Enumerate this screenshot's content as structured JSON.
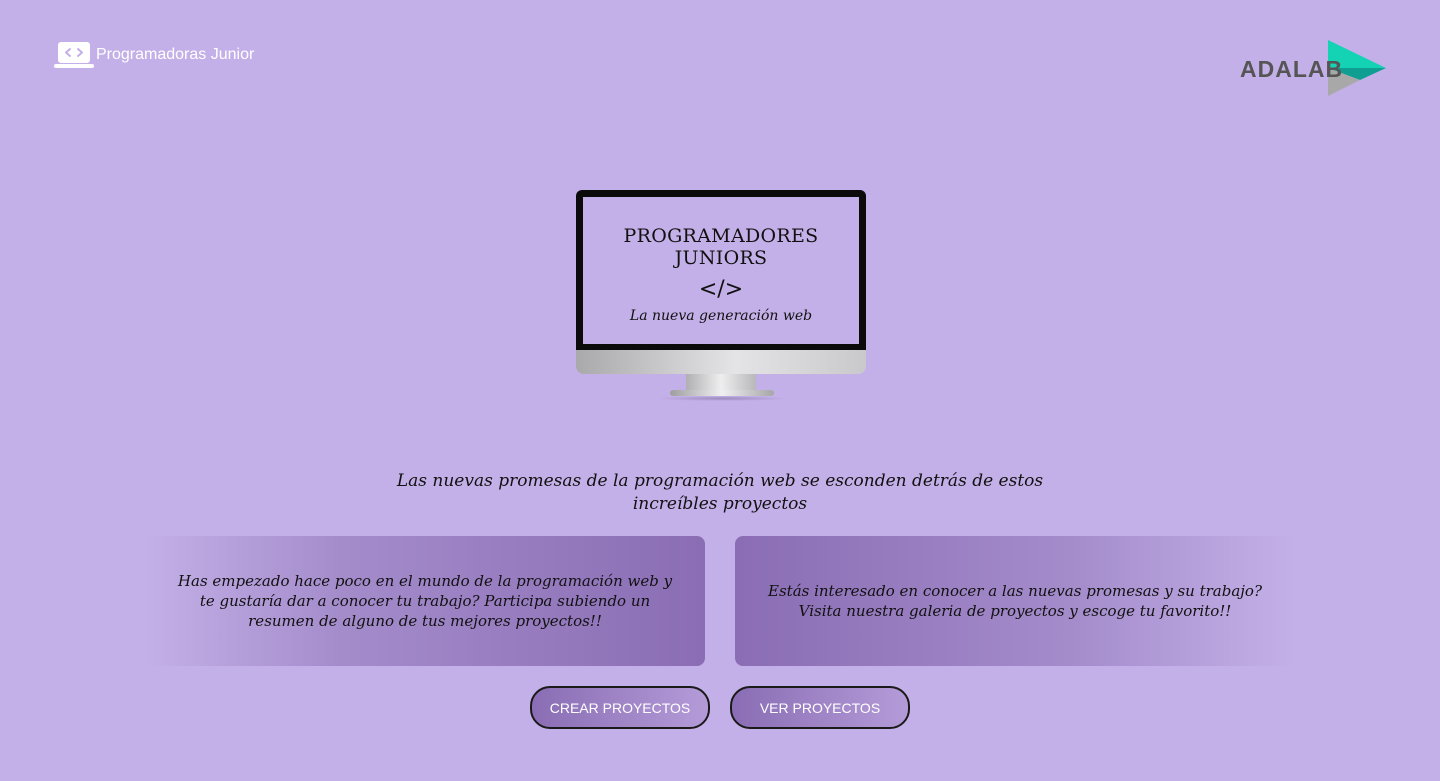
{
  "header": {
    "brand_text": "Programadoras Junior",
    "brand_icon": "laptop-code-icon",
    "logo_text": "ADALAB",
    "logo_colors": {
      "word": "#555555",
      "teal": "#14d3b4",
      "teal_dark": "#0e9e92",
      "gray": "#a8a8a8"
    }
  },
  "hero": {
    "screen_title": "PROGRAMADORES JUNIORS",
    "screen_code": "</>",
    "screen_tagline": "La nueva generación web"
  },
  "intro": {
    "text": "Las nuevas promesas de la programación web se esconden detrás de estos increíbles proyectos"
  },
  "cards": {
    "left_text": "Has empezado hace poco en el mundo de la programación web y te gustaría dar a conocer tu trabajo? Participa subiendo un resumen de alguno de tus mejores proyectos!!",
    "right_text": "Estás interesado en conocer a las nuevas promesas y su trabajo? Visita nuestra galeria de proyectos y escoge tu favorito!!"
  },
  "buttons": {
    "create_label": "CREAR PROYECTOS",
    "view_label": "VER PROYECTOS"
  },
  "colors": {
    "background": "#c4b0e8",
    "card_purple": "#8a6db4",
    "button_border": "#1a1a1a"
  }
}
